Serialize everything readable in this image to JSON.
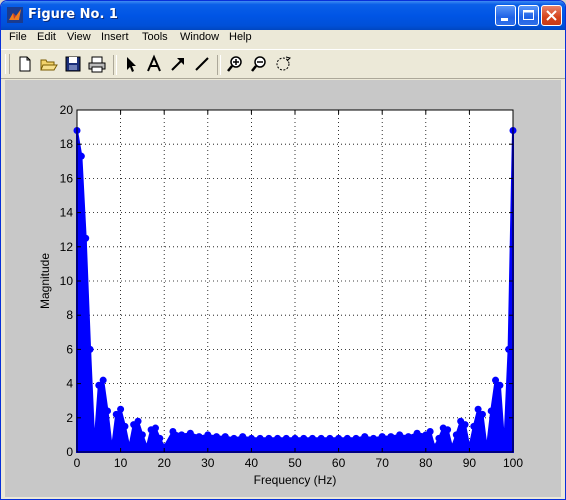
{
  "window": {
    "title": "Figure No. 1"
  },
  "menu": {
    "items": [
      {
        "label": "File"
      },
      {
        "label": "Edit"
      },
      {
        "label": "View"
      },
      {
        "label": "Insert"
      },
      {
        "label": "Tools"
      },
      {
        "label": "Window"
      },
      {
        "label": "Help"
      }
    ]
  },
  "toolbar": {
    "icons": [
      "new-figure-icon",
      "open-file-icon",
      "save-icon",
      "print-icon",
      "select-arrow-icon",
      "insert-text-icon",
      "insert-arrow-icon",
      "insert-line-icon",
      "zoom-in-icon",
      "zoom-out-icon",
      "rotate-3d-icon"
    ]
  },
  "colors": {
    "series": "#0000ff",
    "title_bar": "#0055e5",
    "figure_background": "#c8c8c8",
    "axes_background": "#ffffff"
  },
  "chart_data": {
    "type": "area",
    "title": "",
    "xlabel": "Frequency (Hz)",
    "ylabel": "Magnitude",
    "xlim": [
      0,
      100
    ],
    "ylim": [
      0,
      20
    ],
    "xticks": [
      "0",
      "10",
      "20",
      "30",
      "40",
      "50",
      "60",
      "70",
      "80",
      "90",
      "100"
    ],
    "yticks": [
      "0",
      "2",
      "4",
      "6",
      "8",
      "10",
      "12",
      "14",
      "16",
      "18",
      "20"
    ],
    "grid": true,
    "legend": "none",
    "series": [
      {
        "style": "filled stems",
        "color": "#0000ff",
        "x": [
          0,
          1,
          2,
          3,
          4,
          5,
          6,
          7,
          8,
          9,
          10,
          11,
          12,
          13,
          14,
          15,
          16,
          17,
          18,
          19,
          20,
          22,
          24,
          26,
          28,
          30,
          32,
          34,
          36,
          38,
          40,
          42,
          44,
          46,
          48,
          50,
          52,
          54,
          56,
          58,
          60,
          62,
          64,
          66,
          68,
          70,
          72,
          74,
          76,
          78,
          80,
          81,
          82,
          83,
          84,
          85,
          86,
          87,
          88,
          89,
          90,
          91,
          92,
          93,
          94,
          95,
          96,
          97,
          98,
          99,
          100
        ],
        "y": [
          18.8,
          17.3,
          12.5,
          6.0,
          0.4,
          3.9,
          4.2,
          2.4,
          0.2,
          2.2,
          2.5,
          1.5,
          0.3,
          1.6,
          1.8,
          1.0,
          0.3,
          1.3,
          1.4,
          0.8,
          0.3,
          1.2,
          1.0,
          1.1,
          0.9,
          1.0,
          0.9,
          0.9,
          0.8,
          0.9,
          0.8,
          0.8,
          0.8,
          0.8,
          0.8,
          0.8,
          0.8,
          0.8,
          0.8,
          0.8,
          0.8,
          0.8,
          0.8,
          0.9,
          0.8,
          0.9,
          0.9,
          1.0,
          0.9,
          1.1,
          1.0,
          1.2,
          0.3,
          0.8,
          1.4,
          1.3,
          0.3,
          1.0,
          1.8,
          1.6,
          0.3,
          1.5,
          2.5,
          2.2,
          0.2,
          2.4,
          4.2,
          3.9,
          0.4,
          6.0,
          18.8
        ]
      }
    ]
  }
}
